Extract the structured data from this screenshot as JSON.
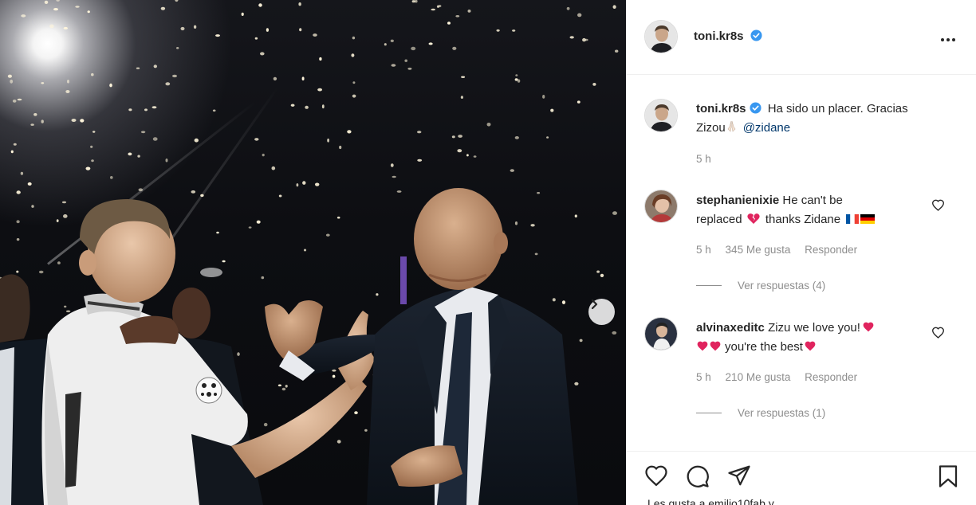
{
  "post": {
    "author": "toni.kr8s",
    "carousel_next_icon": "chevron-right-icon",
    "more_icon": "more-options-icon"
  },
  "caption": {
    "username": "toni.kr8s",
    "text_line1": "Ha sido un placer. Gracias",
    "text_line2_prefix": "Zizou",
    "mention": "@zidane",
    "time": "5 h"
  },
  "comments": [
    {
      "username": "stephanienixie",
      "text_line1": "He can't be",
      "text_line2_a": "replaced",
      "text_line2_b": "thanks Zidane",
      "time": "5 h",
      "likes": "345 Me gusta",
      "reply": "Responder",
      "view_replies": "Ver respuestas (4)"
    },
    {
      "username": "alvinaxeditc",
      "text_line1": "Zizu we love you!",
      "text_line2": "you're the best",
      "time": "5 h",
      "likes": "210 Me gusta",
      "reply": "Responder",
      "view_replies": "Ver respuestas (1)"
    }
  ],
  "actions": {
    "like_icon": "heart-icon",
    "comment_icon": "comment-icon",
    "share_icon": "share-icon",
    "save_icon": "bookmark-icon"
  },
  "likes_summary": "Les gusta a emilio10fab y",
  "colors": {
    "verified": "#3897f0",
    "broken_heart": "#e0245e",
    "heart_emoji": "#e0245e",
    "mention": "#00376b",
    "muted": "#8e8e8e"
  }
}
